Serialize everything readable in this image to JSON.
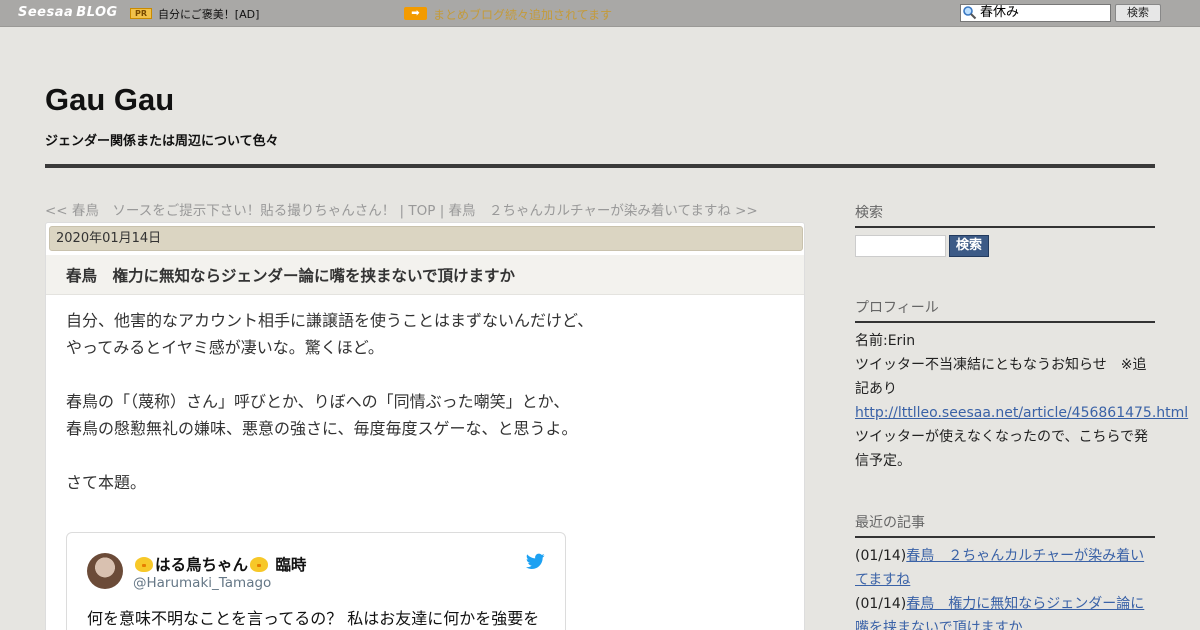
{
  "topbar": {
    "logo": "Seesaa",
    "logo_blog": "BLOG",
    "pr_badge": "PR",
    "pr_text": "自分にご褒美！[AD]",
    "notice_icon": "➡",
    "notice_text": "まとめブログ続々追加されてます",
    "search_value": "春休み",
    "search_button": "検索"
  },
  "header": {
    "title": "Gau Gau",
    "description": "ジェンダー関係または周辺について色々"
  },
  "pager": {
    "prev": "<< 春鳥　ソースをご提示下さい！貼る撮りちゃんさん！",
    "sep1": " | ",
    "top": "TOP",
    "sep2": " | ",
    "next": "春鳥　２ちゃんカルチャーが染み着いてますね >>"
  },
  "article": {
    "date": "2020年01月14日",
    "title": "春鳥　権力に無知ならジェンダー論に嘴を挟まないで頂けますか",
    "lines": [
      "自分、他害的なアカウント相手に謙譲語を使うことはまずないんだけど、",
      "やってみるとイヤミ感が凄いな。驚くほど。",
      "",
      "春鳥の「（蔑称）さん」呼びとか、りぼへの「同情ぶった嘲笑」とか、",
      "春鳥の慇懃無礼の嫌味、悪意の強さに、毎度毎度スゲーな、と思うよ。",
      "",
      "さて本題。"
    ]
  },
  "tweet": {
    "name": "はる鳥ちゃん",
    "name_suffix": "臨時",
    "handle": "@Harumaki_Tamago",
    "text": "何を意味不明なことを言ってるの？ 私はお友達に何かを強要を"
  },
  "sidebar": {
    "search_heading": "検索",
    "search_button": "検索",
    "profile_heading": "プロフィール",
    "profile_name": "名前:Erin",
    "profile_notice": "ツイッター不当凍結にともなうお知らせ　※追記あり",
    "profile_link": "http://lttlleo.seesaa.net/article/456861475.html",
    "profile_note": "ツイッターが使えなくなったので、こちらで発信予定。",
    "recent_heading": "最近の記事",
    "recent": [
      {
        "date": "(01/14)",
        "title": "春鳥　２ちゃんカルチャーが染み着いてますね"
      },
      {
        "date": "(01/14)",
        "title": "春鳥　権力に無知ならジェンダー論に嘴を挟まないで頂けますか"
      }
    ]
  },
  "colors": {
    "page_bg": "#e6e5e1",
    "topbar_bg": "#a9a8a6",
    "date_bar_bg": "#dbd5c2",
    "link": "#3a62a7",
    "search_button_bg": "#3c5a86"
  }
}
